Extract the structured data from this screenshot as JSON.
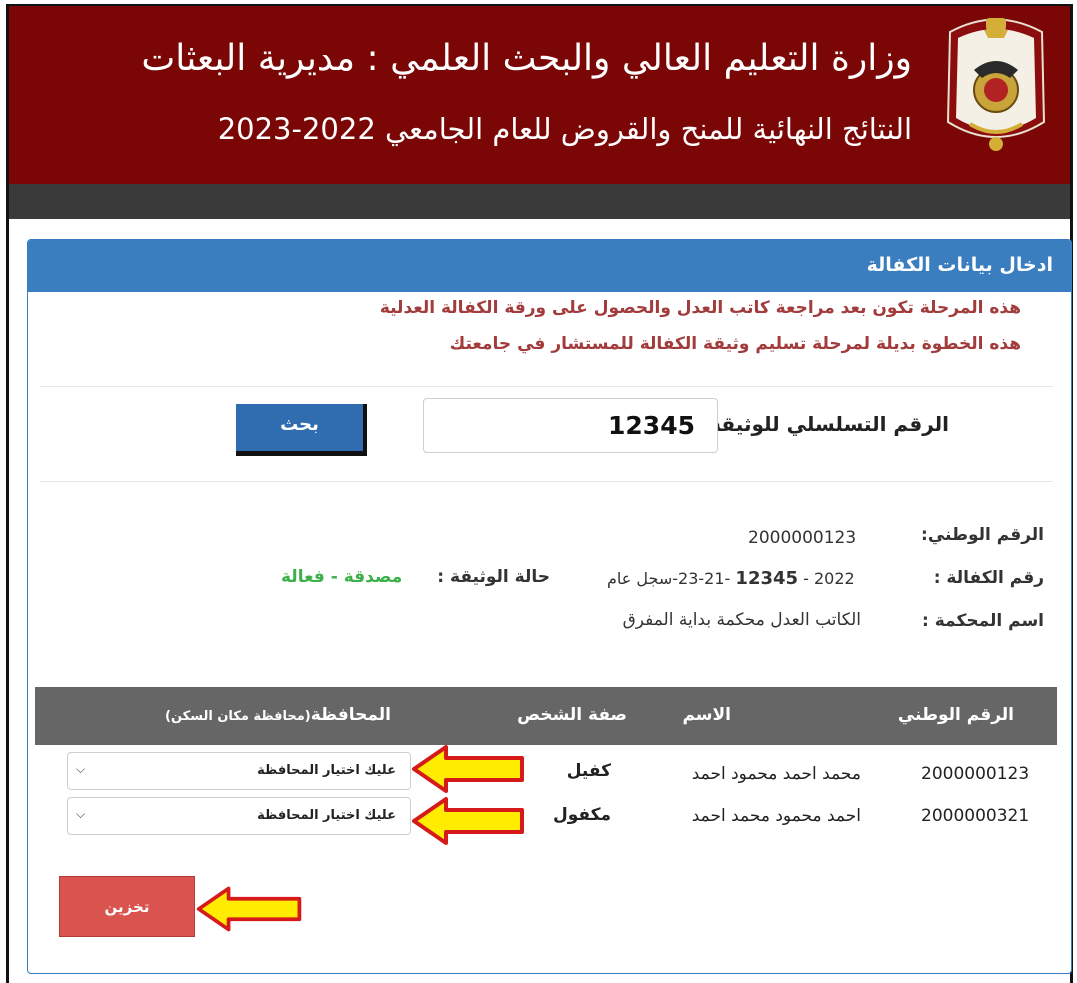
{
  "header": {
    "title": "وزارة التعليم العالي والبحث العلمي : مديرية البعثات",
    "subtitle": "النتائج النهائية للمنح والقروض للعام الجامعي 2022-2023"
  },
  "panel": {
    "title": "ادخال بيانات الكفالة",
    "notes": [
      "هذه المرحلة تكون بعد مراجعة كاتب العدل والحصول على ورقة الكفالة العدلية",
      "هذه الخطوة بديلة لمرحلة تسليم وثيقة الكفالة للمستشار في جامعتك"
    ]
  },
  "search": {
    "label": "الرقم التسلسلي للوثيقة",
    "value": "12345",
    "button_label": "بحث"
  },
  "info": {
    "national_id_label": "الرقم الوطني:",
    "national_id_value": "2000000123",
    "guarantee_no_label": "رقم الكفالة :",
    "guarantee_no_prefix": "2022 -",
    "guarantee_no_bold": "12345",
    "guarantee_no_suffix": "-23-21-سجل عام",
    "doc_status_label": "حالة الوثيقة :",
    "doc_status_value": "مصدقة - فعالة",
    "court_label": "اسم المحكمة :",
    "court_value": "الكاتب العدل محكمة بداية المفرق"
  },
  "table": {
    "headers": {
      "national_id": "الرقم الوطني",
      "name": "الاسم",
      "role": "صفة الشخص",
      "governorate": "المحافظة",
      "governorate_note": "(محافظة مكان السكن)"
    },
    "rows": [
      {
        "national_id": "2000000123",
        "name": "محمد احمد محمود احمد",
        "role": "كفيل",
        "governorate": "عليك اختيار المحافظة"
      },
      {
        "national_id": "2000000321",
        "name": "احمد محمود محمد احمد",
        "role": "مكفول",
        "governorate": "عليك اختيار المحافظة"
      }
    ]
  },
  "save_button_label": "تخزين",
  "colors": {
    "header_bg": "#7a0606",
    "panel_head": "#3a7ec0",
    "note_text": "#a23b3b",
    "status_green": "#3cb04a",
    "save_button": "#d9534f",
    "arrow_fill": "#ffec00",
    "arrow_stroke": "#d61a1a"
  }
}
